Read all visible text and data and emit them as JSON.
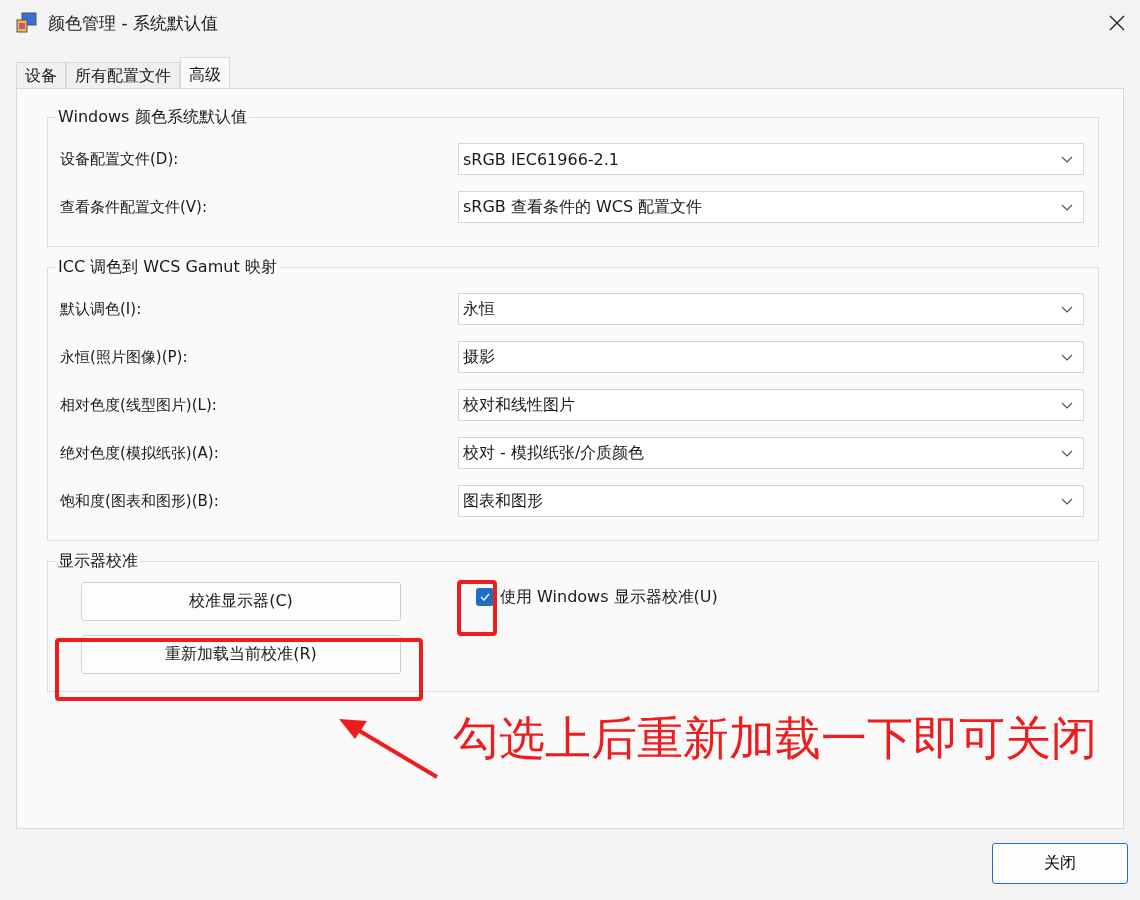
{
  "window": {
    "title": "颜色管理 - 系统默认值"
  },
  "tabs": [
    {
      "label": "设备",
      "selected": false
    },
    {
      "label": "所有配置文件",
      "selected": false
    },
    {
      "label": "高级",
      "selected": true
    }
  ],
  "defaults_group": {
    "title": "Windows 颜色系统默认值",
    "rows": [
      {
        "label": "设备配置文件(D):",
        "value": "sRGB IEC61966-2.1"
      },
      {
        "label": "查看条件配置文件(V):",
        "value": "sRGB 查看条件的 WCS 配置文件"
      }
    ]
  },
  "gamut_group": {
    "title": "ICC 调色到 WCS Gamut 映射",
    "rows": [
      {
        "label": "默认调色(I):",
        "value": "永恒"
      },
      {
        "label": "永恒(照片图像)(P):",
        "value": "摄影"
      },
      {
        "label": "相对色度(线型图片)(L):",
        "value": "校对和线性图片"
      },
      {
        "label": "绝对色度(模拟纸张)(A):",
        "value": "校对 - 模拟纸张/介质颜色"
      },
      {
        "label": "饱和度(图表和图形)(B):",
        "value": "图表和图形"
      }
    ]
  },
  "calibration_group": {
    "title": "显示器校准",
    "buttons": [
      "校准显示器(C)",
      "重新加载当前校准(R)"
    ],
    "checkbox": {
      "label": "使用 Windows 显示器校准(U)",
      "checked": true
    }
  },
  "annotation": {
    "text": "勾选上后重新加载一下即可关闭"
  },
  "close_button": "关闭"
}
